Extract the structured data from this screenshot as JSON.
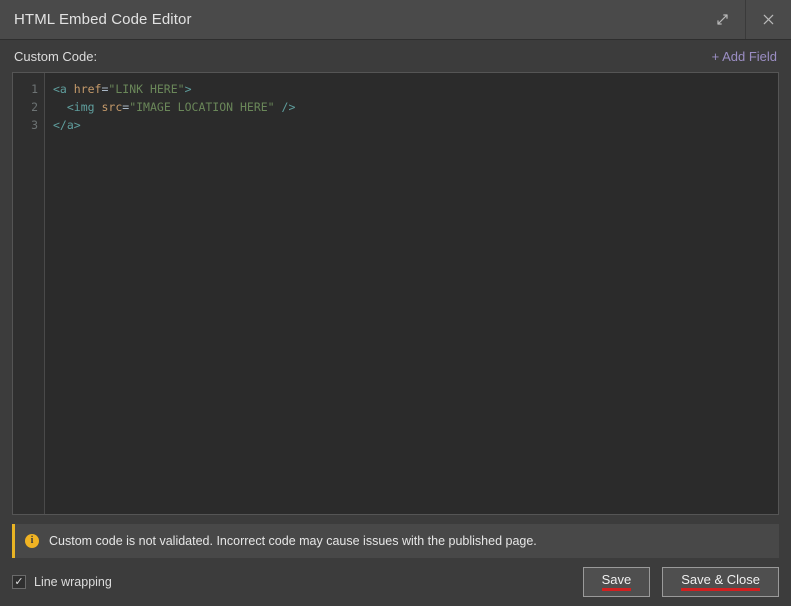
{
  "window": {
    "title": "HTML Embed Code Editor",
    "expand_icon": "expand-diagonal-icon",
    "close_icon": "close-icon"
  },
  "subheader": {
    "label": "Custom Code:",
    "add_field_label": "+ Add Field"
  },
  "editor": {
    "line_numbers": [
      "1",
      "2",
      "3"
    ],
    "lines": [
      {
        "number": "1",
        "tokens": [
          {
            "type": "tag",
            "text": "<a "
          },
          {
            "type": "attr",
            "text": "href"
          },
          {
            "type": "eq",
            "text": "="
          },
          {
            "type": "str",
            "text": "\"LINK HERE\""
          },
          {
            "type": "tag",
            "text": ">"
          }
        ]
      },
      {
        "number": "2",
        "tokens": [
          {
            "type": "plain",
            "text": "  "
          },
          {
            "type": "tag",
            "text": "<img "
          },
          {
            "type": "attr",
            "text": "src"
          },
          {
            "type": "eq",
            "text": "="
          },
          {
            "type": "str",
            "text": "\"IMAGE LOCATION HERE\""
          },
          {
            "type": "plain",
            "text": " "
          },
          {
            "type": "tag",
            "text": "/>"
          }
        ]
      },
      {
        "number": "3",
        "tokens": [
          {
            "type": "tag",
            "text": "</a>"
          }
        ]
      }
    ],
    "plain_text": "<a href=\"LINK HERE\">\n  <img src=\"IMAGE LOCATION HERE\" />\n</a>"
  },
  "warning": {
    "icon": "info-circle-icon",
    "text": "Custom code is not validated. Incorrect code may cause issues with the published page."
  },
  "footer": {
    "line_wrapping_label": "Line wrapping",
    "line_wrapping_checked": true,
    "checkmark": "✓",
    "save_label": "Save",
    "save_close_label": "Save & Close"
  },
  "colors": {
    "titlebar_bg": "#4a4a4a",
    "dialog_bg": "#3c3c3c",
    "editor_bg": "#2b2b2b",
    "gutter_bg": "#2f2f2f",
    "accent_add_field": "#9b8ec4",
    "warning_accent": "#e8b324",
    "button_underline": "#d32020",
    "code_tag": "#5f9e9d",
    "code_attr": "#c59a6a",
    "code_string": "#6a8759"
  }
}
